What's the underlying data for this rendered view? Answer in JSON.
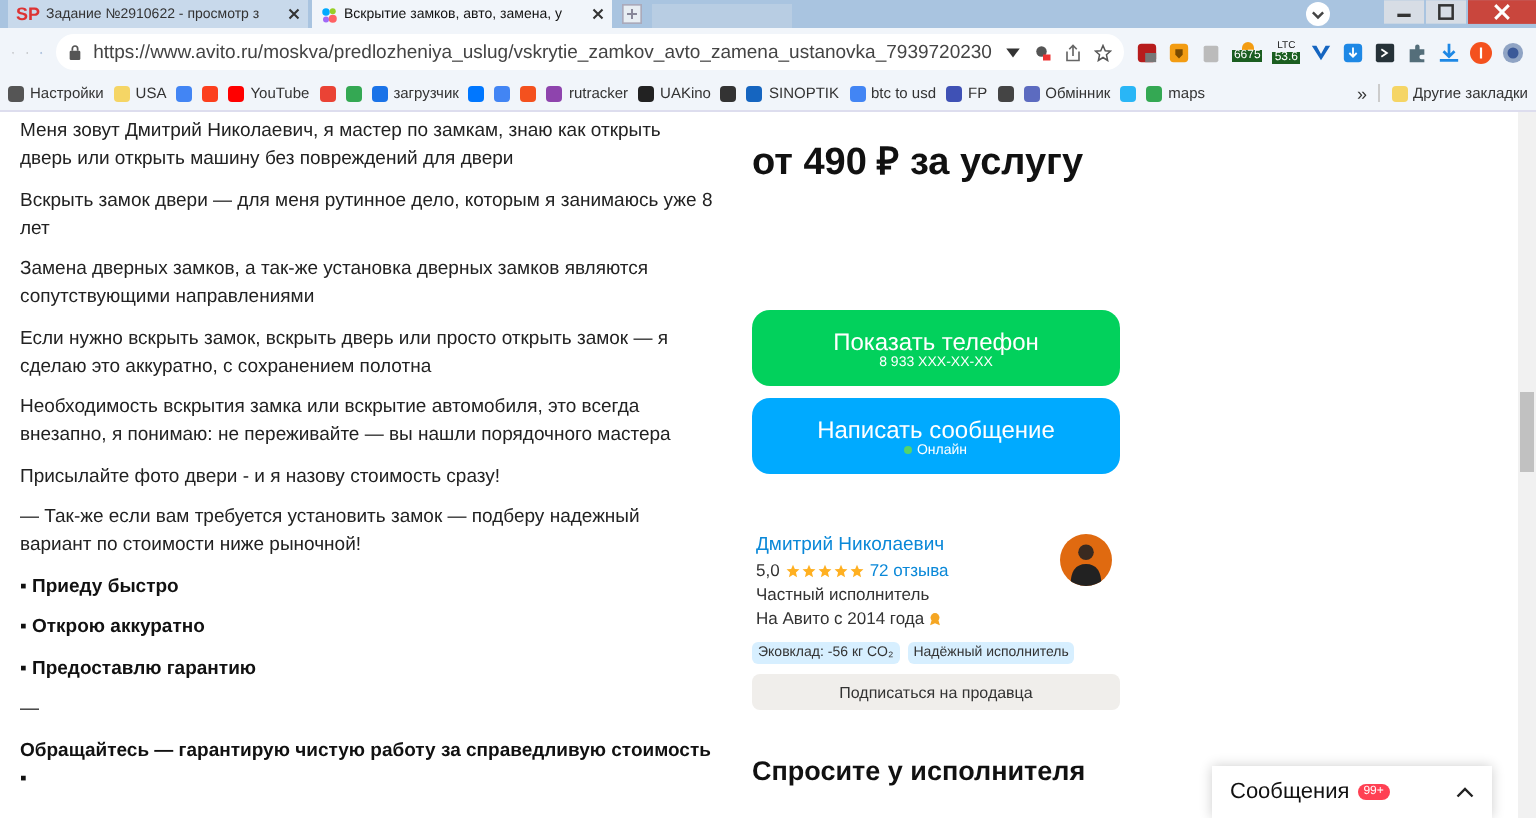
{
  "browser": {
    "tabs": [
      {
        "title": "Задание №2910622 - просмотр з",
        "badge": "SP",
        "selected": false
      },
      {
        "title": "Вскрытие замков, авто, замена, у",
        "selected": true
      }
    ],
    "url": "https://www.avito.ru/moskva/predlozheniya_uslug/vskrytie_zamkov_avto_zamena_ustanovka_7939720230",
    "extensions": [
      {
        "kind": "badge",
        "label": "6675"
      },
      {
        "kind": "badge",
        "label": "53.6",
        "caption": "LTC"
      }
    ],
    "bookmarks": [
      {
        "kind": "link",
        "label": "Настройки"
      },
      {
        "kind": "link",
        "label": "USA"
      },
      {
        "kind": "icon"
      },
      {
        "kind": "icon"
      },
      {
        "kind": "link",
        "label": "YouTube"
      },
      {
        "kind": "icon"
      },
      {
        "kind": "icon"
      },
      {
        "kind": "link",
        "label": "загрузчик"
      },
      {
        "kind": "icon"
      },
      {
        "kind": "icon"
      },
      {
        "kind": "icon"
      },
      {
        "kind": "link",
        "label": "rutracker"
      },
      {
        "kind": "link",
        "label": "UAKino"
      },
      {
        "kind": "icon"
      },
      {
        "kind": "link",
        "label": "SINOPTIK"
      },
      {
        "kind": "link",
        "label": "btc to usd"
      },
      {
        "kind": "link",
        "label": "FP"
      },
      {
        "kind": "icon"
      },
      {
        "kind": "link",
        "label": "Обмінник"
      },
      {
        "kind": "icon"
      },
      {
        "kind": "link",
        "label": "maps"
      }
    ],
    "more": "»",
    "other_bookmarks": "Другие закладки"
  },
  "description": {
    "paragraphs": [
      {
        "kind": "text",
        "text": "Меня зовут Дмитрий Николаевич, я мастер по замкам, знаю как открыть дверь или открыть машину без повреждений для двери"
      },
      {
        "kind": "text",
        "text": "Вскрыть замок двери — для меня рутинное дело, которым я занимаюсь уже 8 лет"
      },
      {
        "kind": "text",
        "text": "Замена дверных замков, а так-же установка дверных замков являются сопутствующими направлениями"
      },
      {
        "kind": "text",
        "text": "Если нужно вскрыть замок, вскрыть дверь или просто открыть замок — я сделаю это аккуратно, с сохранением полотна"
      },
      {
        "kind": "text",
        "text": "Необходимость вскрытия замка или вскрытие автомобиля, это всегда внезапно, я понимаю: не переживайте — вы нашли порядочного мастера"
      },
      {
        "kind": "text",
        "text": "Присылайте фото двери - и я назову стоимость сразу!"
      },
      {
        "kind": "text",
        "text": "— Так-же если вам требуется установить замок — подберу надежный вариант по стоимости ниже рыночной!"
      },
      {
        "kind": "bold",
        "text": "▪ Приеду быстро"
      },
      {
        "kind": "bold",
        "text": "▪ Открою аккуратно"
      },
      {
        "kind": "bold",
        "text": "▪ Предоставлю гарантию"
      },
      {
        "kind": "text",
        "text": "—"
      },
      {
        "kind": "bold",
        "text": "Обращайтесь — гарантирую чистую работу за справедливую стоимость ▪"
      }
    ]
  },
  "offer": {
    "price": "от 490 ₽ за услугу",
    "phone_button": {
      "label": "Показать телефон",
      "sub": "8 933 XXX-XX-XX"
    },
    "message_button": {
      "label": "Написать сообщение",
      "status": "Онлайн",
      "online": true
    }
  },
  "seller": {
    "name": "Дмитрий Николаевич",
    "rating": "5,0",
    "stars": 5,
    "reviews": "72 отзыва",
    "type": "Частный исполнитель",
    "since": "На Авито с 2014 года",
    "tags": [
      "Эковклад: -56 кг CO₂",
      "Надёжный исполнитель"
    ],
    "subscribe": "Подписаться на продавца"
  },
  "ask": {
    "title": "Спросите у исполнителя"
  },
  "messages": {
    "label": "Сообщения",
    "count": "99+"
  }
}
